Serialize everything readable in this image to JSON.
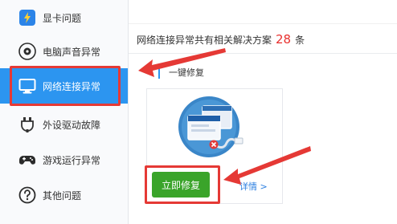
{
  "sidebar": {
    "items": [
      {
        "label": "显卡问题",
        "icon": "graphics-card-icon"
      },
      {
        "label": "电脑声音异常",
        "icon": "speaker-icon"
      },
      {
        "label": "网络连接异常",
        "icon": "monitor-icon",
        "active": true
      },
      {
        "label": "外设驱动故障",
        "icon": "usb-plug-icon"
      },
      {
        "label": "游戏运行异常",
        "icon": "gamepad-icon"
      },
      {
        "label": "其他问题",
        "icon": "question-icon"
      }
    ]
  },
  "main": {
    "summary_prefix": "网络连接异常共有相关解决方案",
    "solution_count": "28",
    "summary_suffix": "条",
    "repair_tab": "一键修复",
    "fix_button": "立即修复",
    "details_link": "详情 >"
  },
  "colors": {
    "accent_blue": "#2c95f0",
    "fix_green": "#3aa42a",
    "highlight_red": "#e53935",
    "count_red": "#e8302e"
  }
}
